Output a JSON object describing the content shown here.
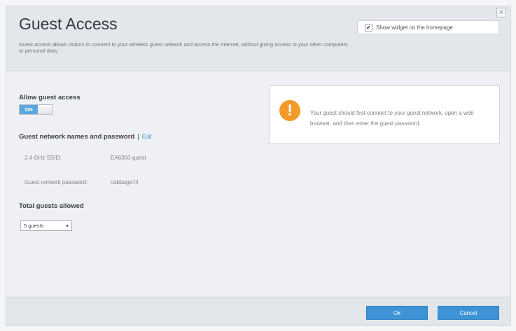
{
  "header": {
    "title": "Guest Access",
    "description": "Guest access allows visitors to connect to your wireless guest network and access the Internet, without giving access to your other computers or personal data.",
    "widget_checkbox": {
      "checked": true,
      "label": "Show widget on the homepage"
    },
    "close_icon": "close-icon"
  },
  "allow_guest": {
    "label": "Allow guest access",
    "toggle": "ON"
  },
  "network": {
    "heading": "Guest network names and password",
    "separator": "|",
    "edit": "Edit",
    "ssid_label": "2.4 GHz SSID:",
    "ssid_value": "EA6350-guest",
    "password_label": "Guest network password:",
    "password_value": "cabbage74"
  },
  "guests": {
    "label": "Total guests allowed",
    "selected": "5 guests"
  },
  "info": {
    "icon": "warning-icon",
    "icon_glyph": "!",
    "text": "Your guest should first connect to your guest network, open a web browser, and then enter the guest password."
  },
  "footer": {
    "ok": "Ok",
    "cancel": "Cancel"
  },
  "colors": {
    "accent": "#3e93d6",
    "warning": "#f39a2b"
  }
}
